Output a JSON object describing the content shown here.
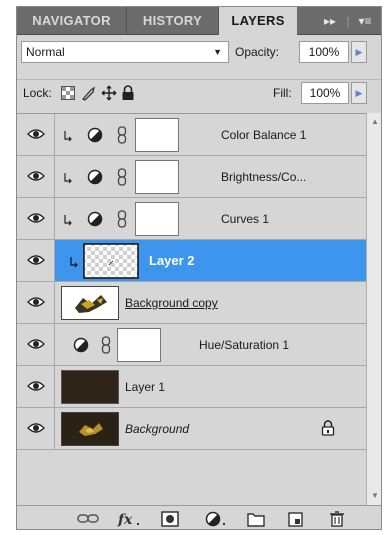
{
  "tabs": {
    "navigator": "NAVIGATOR",
    "history": "HISTORY",
    "layers": "LAYERS",
    "collapse": "▸▸",
    "separator": "|",
    "menu": "▾≡"
  },
  "blend": {
    "mode": "Normal",
    "opacity_label": "Opacity:",
    "opacity_value": "100%"
  },
  "lock": {
    "label": "Lock:",
    "fill_label": "Fill:",
    "fill_value": "100%"
  },
  "layers": [
    {
      "name": "Color Balance 1",
      "kind": "adjustment-clipped",
      "adjustment_icon": "contrast-icon"
    },
    {
      "name": "Brightness/Co...",
      "kind": "adjustment-clipped",
      "adjustment_icon": "contrast-icon"
    },
    {
      "name": "Curves 1",
      "kind": "adjustment-clipped",
      "adjustment_icon": "contrast-icon"
    },
    {
      "name": "Layer 2",
      "kind": "pixel-clipped",
      "selected": true
    },
    {
      "name": "Background copy",
      "kind": "pixel",
      "underlined": true
    },
    {
      "name": "Hue/Saturation 1",
      "kind": "adjustment",
      "adjustment_icon": "contrast-icon"
    },
    {
      "name": "Layer 1",
      "kind": "pixel"
    },
    {
      "name": "Background",
      "kind": "background",
      "italic": true,
      "locked": true
    }
  ],
  "footer_icons": [
    "link-layers-icon",
    "fx-icon",
    "add-mask-icon",
    "new-adjustment-icon",
    "new-group-icon",
    "new-layer-icon",
    "trash-icon"
  ],
  "colors": {
    "selection": "#3d95ed",
    "panel": "#d6d6d6",
    "tabbar": "#6b6b6b"
  }
}
